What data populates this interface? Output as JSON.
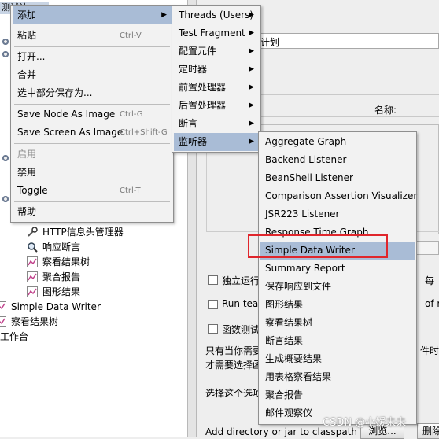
{
  "tree": {
    "root_label": "测试计",
    "items": [
      {
        "label": "HTTP信息头管理器",
        "icon": "wrench-icon"
      },
      {
        "label": "响应断言",
        "icon": "magnifier-icon"
      },
      {
        "label": "察看结果树",
        "icon": "chart-icon"
      },
      {
        "label": "聚合报告",
        "icon": "chart-icon"
      },
      {
        "label": "图形结果",
        "icon": "chart-icon"
      },
      {
        "label": "Simple Data Writer",
        "icon": "chart-icon"
      },
      {
        "label": "察看结果树",
        "icon": "chart-icon"
      },
      {
        "label": "工作台",
        "icon": "workbench-icon"
      }
    ]
  },
  "right_panel": {
    "name_value": "计划",
    "name_label": "名称:",
    "checkbox_1": "独立运行",
    "checkbox_1_tail": "每",
    "checkbox_2": "Run tear",
    "checkbox_2_tail": "of m",
    "checkbox_3": "函数测试",
    "note_line1": "只有当你需要",
    "note_line1_tail": "件时",
    "note_line2": "才需要选择函",
    "select_label": "选择这个选项",
    "classpath_label": "Add directory or jar to classpath",
    "browse_button": "浏览...",
    "delete_button": "删除"
  },
  "context_menu": {
    "items": [
      {
        "label": "添加",
        "submenu": true,
        "selected": true
      },
      {
        "label": "粘贴",
        "shortcut": "Ctrl-V"
      },
      {
        "label": "打开..."
      },
      {
        "label": "合并"
      },
      {
        "label": "选中部分保存为..."
      },
      {
        "label": "Save Node As Image",
        "shortcut": "Ctrl-G"
      },
      {
        "label": "Save Screen As Image",
        "shortcut": "Ctrl+Shift-G"
      },
      {
        "label": "启用",
        "disabled": true
      },
      {
        "label": "禁用"
      },
      {
        "label": "Toggle",
        "shortcut": "Ctrl-T"
      },
      {
        "label": "帮助"
      }
    ]
  },
  "add_submenu": {
    "items": [
      {
        "label": "Threads (Users)"
      },
      {
        "label": "Test Fragment"
      },
      {
        "label": "配置元件"
      },
      {
        "label": "定时器"
      },
      {
        "label": "前置处理器"
      },
      {
        "label": "后置处理器"
      },
      {
        "label": "断言"
      },
      {
        "label": "监听器",
        "selected": true
      }
    ]
  },
  "listener_submenu": {
    "items": [
      "Aggregate Graph",
      "Backend Listener",
      "BeanShell Listener",
      "Comparison Assertion Visualizer",
      "JSR223 Listener",
      "Response Time Graph",
      "Simple Data Writer",
      "Summary Report",
      "保存响应到文件",
      "图形结果",
      "察看结果树",
      "断言结果",
      "生成概要结果",
      "用表格察看结果",
      "聚合报告",
      "邮件观察仪"
    ],
    "selected": "Simple Data Writer"
  },
  "watermark": "CSDN @小嫒未未",
  "colors": {
    "selection": "#a9bcd6",
    "highlight_border": "#e0262c",
    "menu_bg": "#f2f2f2"
  }
}
